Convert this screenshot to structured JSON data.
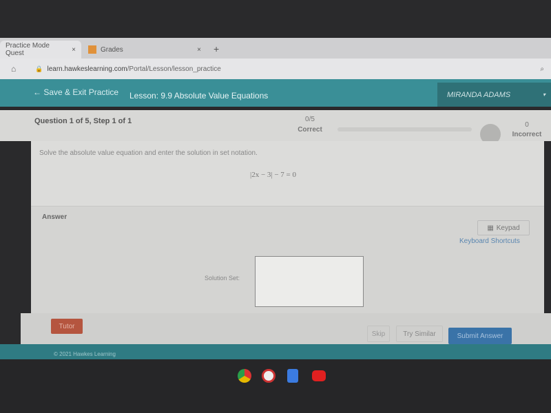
{
  "browser": {
    "tabs": [
      {
        "label": "Practice Mode Quest",
        "close": "×"
      },
      {
        "label": "Grades",
        "close": "×"
      }
    ],
    "new_tab": "+",
    "url_domain": "learn.hawkeslearning.com",
    "url_path": "/Portal/Lesson/lesson_practice"
  },
  "header": {
    "back_label": "Save & Exit Practice",
    "lesson": "Lesson: 9.9 Absolute Value Equations",
    "user": "MIRANDA ADAMS"
  },
  "progress": {
    "question": "Question 1 of 5, Step 1 of 1",
    "correct_count": "0/5",
    "correct_label": "Correct",
    "incorrect_count": "0",
    "incorrect_label": "Incorrect",
    "fraction": 0
  },
  "problem": {
    "instruction": "Solve the absolute value equation and enter the solution in set notation.",
    "equation": "|2x − 3| − 7 = 0"
  },
  "answer": {
    "label": "Answer",
    "keypad": "Keypad",
    "shortcuts": "Keyboard Shortcuts",
    "solution_label": "Solution Set:",
    "solution_value": ""
  },
  "buttons": {
    "tutor": "Tutor",
    "skip": "Skip",
    "try_similar": "Try Similar",
    "submit": "Submit Answer"
  },
  "footer": "© 2021 Hawkes Learning",
  "colors": {
    "teal": "#3a8f97",
    "submit": "#3a73a8",
    "tutor": "#b5553f"
  }
}
